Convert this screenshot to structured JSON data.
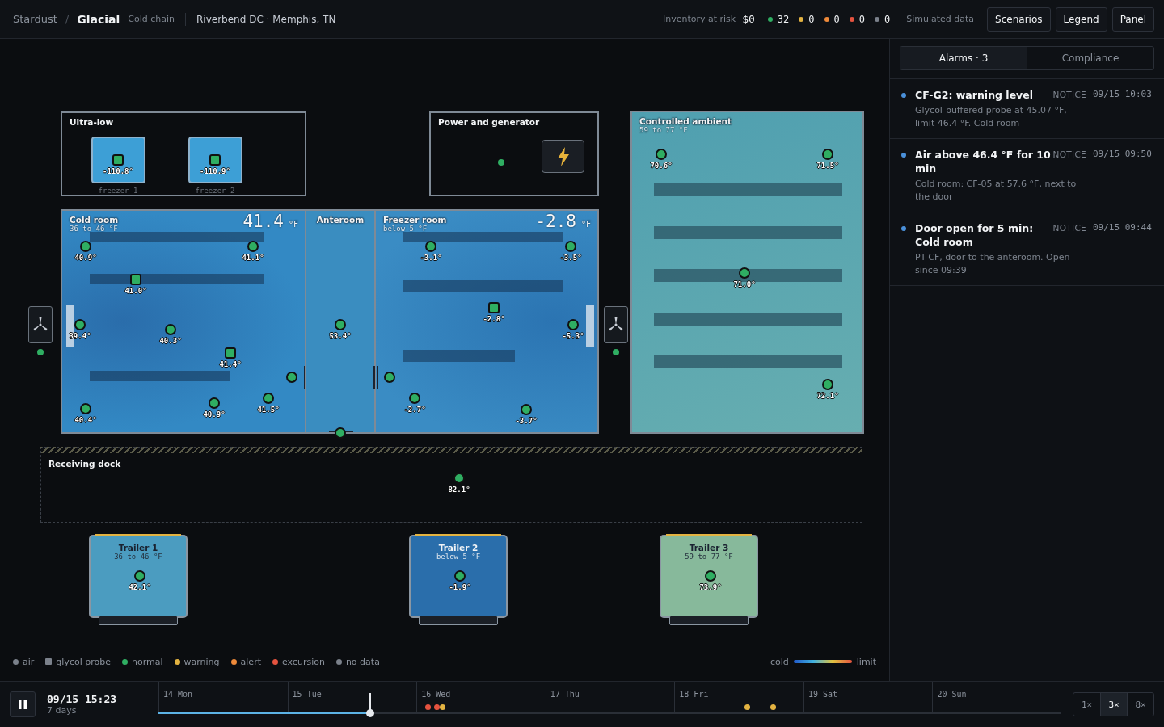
{
  "header": {
    "brand": "Stardust",
    "separator": "/",
    "product": "Glacial",
    "subtitle": "Cold chain",
    "site": "Riverbend DC · Memphis, TN",
    "risk_label": "Inventory at risk",
    "risk_value": "$0",
    "counts": [
      {
        "value": "32",
        "color": "#2fae62"
      },
      {
        "value": "0",
        "color": "#e3b341"
      },
      {
        "value": "0",
        "color": "#ef8a3a"
      },
      {
        "value": "0",
        "color": "#e5533f"
      },
      {
        "value": "0",
        "color": "#7b818b"
      }
    ],
    "note": "Simulated data",
    "buttons": [
      "Scenarios",
      "Legend",
      "Panel"
    ]
  },
  "map": {
    "ultra_low": {
      "title": "Ultra-low",
      "freezers": [
        {
          "label": "freezer 1",
          "sensor": {
            "kind": "glycol",
            "reading": "-110.8°",
            "color": "#2fae62"
          }
        },
        {
          "label": "freezer 2",
          "sensor": {
            "kind": "glycol",
            "reading": "-110.9°",
            "color": "#2fae62"
          }
        }
      ]
    },
    "power": {
      "title": "Power and generator",
      "color": "#2fae62"
    },
    "fans": [
      {
        "color": "#2fae62"
      },
      {
        "color": "#2fae62"
      }
    ],
    "rooms": [
      {
        "kind": "cold",
        "name": "Cold room",
        "range": "36 to 46 °F",
        "reading": "41.4",
        "unit": "°F",
        "sensors": [
          {
            "kind": "air",
            "reading": "40.9°",
            "color": "#2fae62"
          },
          {
            "kind": "air",
            "reading": "41.1°",
            "color": "#2fae62"
          },
          {
            "kind": "glycol",
            "reading": "41.0°",
            "color": "#2fae62"
          },
          {
            "kind": "air",
            "reading": "39.4°",
            "color": "#2fae62"
          },
          {
            "kind": "air",
            "reading": "40.3°",
            "color": "#2fae62"
          },
          {
            "kind": "glycol",
            "reading": "41.4°",
            "color": "#2fae62"
          },
          {
            "kind": "air",
            "color": "#2fae62"
          },
          {
            "kind": "air",
            "reading": "40.4°",
            "color": "#2fae62"
          },
          {
            "kind": "air",
            "reading": "40.9°",
            "color": "#2fae62"
          },
          {
            "kind": "air",
            "reading": "41.5°",
            "color": "#2fae62"
          }
        ]
      },
      {
        "kind": "ante",
        "name": "Anteroom",
        "sensors": [
          {
            "kind": "air",
            "reading": "53.4°",
            "color": "#2fae62"
          },
          {
            "kind": "air",
            "color": "#2fae62"
          }
        ]
      },
      {
        "kind": "freezer",
        "name": "Freezer room",
        "range": "below 5 °F",
        "reading": "-2.8",
        "unit": "°F",
        "sensors": [
          {
            "kind": "air",
            "reading": "-3.1°",
            "color": "#2fae62"
          },
          {
            "kind": "air",
            "reading": "-3.5°",
            "color": "#2fae62"
          },
          {
            "kind": "glycol",
            "reading": "-2.8°",
            "color": "#2fae62"
          },
          {
            "kind": "air",
            "reading": "-5.3°",
            "color": "#2fae62"
          },
          {
            "kind": "air",
            "color": "#2fae62"
          },
          {
            "kind": "air",
            "reading": "-2.7°",
            "color": "#2fae62"
          },
          {
            "kind": "air",
            "reading": "-3.7°",
            "color": "#2fae62"
          }
        ]
      },
      {
        "kind": "ambient",
        "name": "Controlled ambient",
        "range": "59 to 77 °F",
        "sensors": [
          {
            "kind": "air",
            "reading": "70.6°",
            "color": "#2fae62"
          },
          {
            "kind": "air",
            "reading": "71.5°",
            "color": "#2fae62"
          },
          {
            "kind": "air",
            "reading": "71.0°",
            "color": "#2fae62"
          },
          {
            "kind": "air",
            "reading": "72.1°",
            "color": "#2fae62"
          }
        ]
      }
    ],
    "dock": {
      "title": "Receiving dock",
      "sensors": [
        {
          "kind": "air",
          "reading": "82.1°",
          "color": "#2fae62"
        }
      ]
    },
    "trailers": [
      {
        "kind": "chilled",
        "name": "Trailer 1",
        "range": "36 to 46 °F",
        "sensors": [
          {
            "kind": "air",
            "reading": "42.1°",
            "color": "#2fae62"
          }
        ]
      },
      {
        "kind": "frozen",
        "name": "Trailer 2",
        "range": "below 5 °F",
        "sensors": [
          {
            "kind": "air",
            "reading": "-1.9°",
            "color": "#2fae62"
          }
        ]
      },
      {
        "kind": "ambient",
        "name": "Trailer 3",
        "range": "59 to 77 °F",
        "sensors": [
          {
            "kind": "air",
            "reading": "73.9°",
            "color": "#2fae62"
          }
        ]
      }
    ]
  },
  "legend": {
    "items": [
      {
        "kind": "air",
        "label": "air",
        "color": "#7b818b"
      },
      {
        "kind": "glycol",
        "label": "glycol probe",
        "color": "#7b818b"
      },
      {
        "kind": "status",
        "label": "normal",
        "color": "#2fae62"
      },
      {
        "kind": "status",
        "label": "warning",
        "color": "#e3b341"
      },
      {
        "kind": "status",
        "label": "alert",
        "color": "#ef8a3a"
      },
      {
        "kind": "status",
        "label": "excursion",
        "color": "#e5533f"
      },
      {
        "kind": "status",
        "label": "no data",
        "color": "#7b818b"
      }
    ],
    "scale": {
      "low": "cold",
      "high": "limit"
    }
  },
  "panel": {
    "tabs": [
      {
        "label": "Alarms · 3",
        "selected": true
      },
      {
        "label": "Compliance",
        "selected": false
      }
    ],
    "alarms": [
      {
        "title": "CF-G2: warning level",
        "severity": "NOTICE",
        "time": "09/15 10:03",
        "detail": "Glycol-buffered probe at 45.07 °F, limit 46.4 °F. Cold room",
        "color": "#4a90d9"
      },
      {
        "title": "Air above 46.4 °F for 10 min",
        "severity": "NOTICE",
        "time": "09/15 09:50",
        "detail": "Cold room: CF-05 at 57.6 °F, next to the door",
        "color": "#4a90d9"
      },
      {
        "title": "Door open for 5 min: Cold room",
        "severity": "NOTICE",
        "time": "09/15 09:44",
        "detail": "PT-CF, door to the anteroom. Open since 09:39",
        "color": "#4a90d9"
      }
    ]
  },
  "timeline": {
    "playing": true,
    "time": "09/15 15:23",
    "span": "7 days",
    "days": [
      "14 Mon",
      "15 Tue",
      "16 Wed",
      "17 Thu",
      "18 Fri",
      "19 Sat",
      "20 Sun"
    ],
    "level": 0.2346,
    "events": [
      {
        "color": "#e5533f"
      },
      {
        "color": "#e5533f"
      },
      {
        "color": "#e3b341"
      },
      {
        "color": "#e3b341"
      },
      {
        "color": "#e3b341"
      }
    ],
    "speeds": [
      {
        "label": "1×",
        "selected": false
      },
      {
        "label": "3×",
        "selected": true
      },
      {
        "label": "8×",
        "selected": false
      }
    ]
  }
}
